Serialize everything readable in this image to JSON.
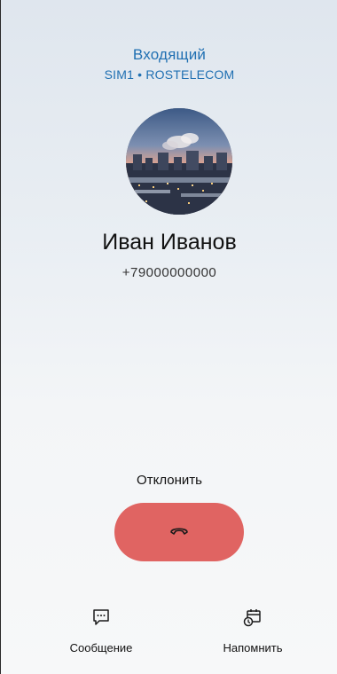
{
  "call": {
    "status": "Входящий",
    "sim_info": "SIM1 • ROSTELECOM"
  },
  "contact": {
    "name": "Иван Иванов",
    "number": "+79000000000",
    "avatar": "city-sunset-photo"
  },
  "decline": {
    "label": "Отклонить",
    "icon": "end-call-icon",
    "color": "#e06462"
  },
  "actions": {
    "message": {
      "label": "Сообщение",
      "icon": "message-icon"
    },
    "remind": {
      "label": "Напомнить",
      "icon": "reminder-icon"
    }
  },
  "colors": {
    "accent": "#1f6fb2",
    "decline": "#e06462"
  }
}
